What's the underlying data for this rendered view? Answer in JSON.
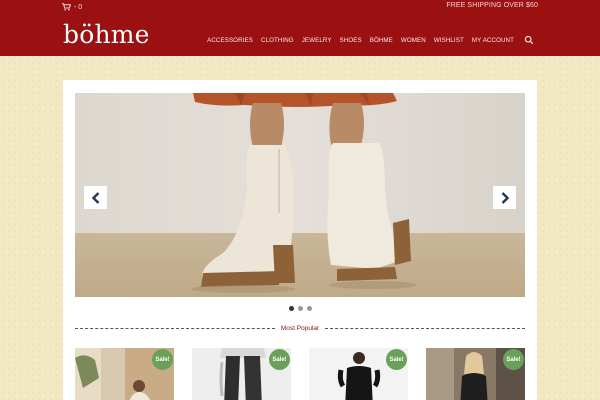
{
  "header": {
    "cart_count": "- 0",
    "shipping_note": "FREE SHIPPING OVER $60",
    "logo": "böhme"
  },
  "nav": {
    "items": [
      {
        "label": "ACCESSORIES"
      },
      {
        "label": "CLOTHING"
      },
      {
        "label": "JEWELRY"
      },
      {
        "label": "SHOES"
      },
      {
        "label": "BÖHME"
      },
      {
        "label": "WOMEN"
      },
      {
        "label": "WISHLIST"
      },
      {
        "label": "MY ACCOUNT"
      }
    ],
    "search_icon": "search-icon"
  },
  "slider": {
    "slide_count": 3,
    "active_slide": 1,
    "prev_icon": "chevron-left-icon",
    "next_icon": "chevron-right-icon"
  },
  "section": {
    "title": "Most Popular"
  },
  "products": [
    {
      "badge": "Sale!"
    },
    {
      "badge": "Sale!"
    },
    {
      "badge": "Sale!"
    },
    {
      "badge": "Sale!"
    }
  ],
  "colors": {
    "header_bg": "#9b1010",
    "page_bg": "#f1e8c4",
    "sale_badge": "#6aa15a",
    "section_title": "#8a1010"
  }
}
